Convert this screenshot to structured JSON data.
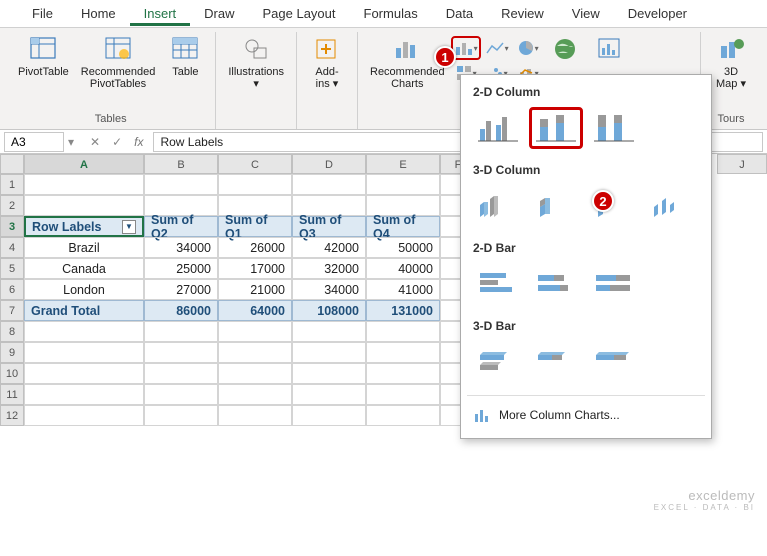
{
  "ribbon_tabs": [
    "File",
    "Home",
    "Insert",
    "Draw",
    "Page Layout",
    "Formulas",
    "Data",
    "Review",
    "View",
    "Developer"
  ],
  "active_tab_index": 2,
  "groups": {
    "tables": {
      "pivot": "PivotTable",
      "recpivot_l1": "Recommended",
      "recpivot_l2": "PivotTables",
      "table": "Table",
      "label": "Tables"
    },
    "illus": {
      "label_top": "Illustrations"
    },
    "addins": {
      "l1": "Add-",
      "l2": "ins",
      "label": ""
    },
    "charts": {
      "rec_l1": "Recommended",
      "rec_l2": "Charts",
      "label": ""
    },
    "tours": {
      "map_l1": "3D",
      "map_l2": "Map",
      "label": "Tours"
    }
  },
  "namebox": "A3",
  "formula": "Row Labels",
  "columns": [
    "A",
    "B",
    "C",
    "D",
    "E",
    "F"
  ],
  "row_nums": [
    1,
    2,
    3,
    4,
    5,
    6,
    7,
    8,
    9,
    10,
    11,
    12
  ],
  "extra_cols": [
    "J"
  ],
  "pivot": {
    "headers": [
      "Row Labels",
      "Sum of Q2",
      "Sum of Q1",
      "Sum of Q3",
      "Sum of Q4"
    ],
    "rows": [
      {
        "label": "Brazil",
        "vals": [
          34000,
          26000,
          42000,
          50000
        ]
      },
      {
        "label": "Canada",
        "vals": [
          25000,
          17000,
          32000,
          40000
        ]
      },
      {
        "label": "London",
        "vals": [
          27000,
          21000,
          34000,
          41000
        ]
      }
    ],
    "total_label": "Grand Total",
    "totals": [
      86000,
      64000,
      108000,
      131000
    ]
  },
  "chart_menu": {
    "g1": "2-D Column",
    "g2": "3-D Column",
    "g3": "2-D Bar",
    "g4": "3-D Bar",
    "more": "More Column Charts..."
  },
  "callouts": {
    "c1": "1",
    "c2": "2"
  },
  "watermark": {
    "main": "exceldemy",
    "sub": "EXCEL · DATA · BI"
  }
}
